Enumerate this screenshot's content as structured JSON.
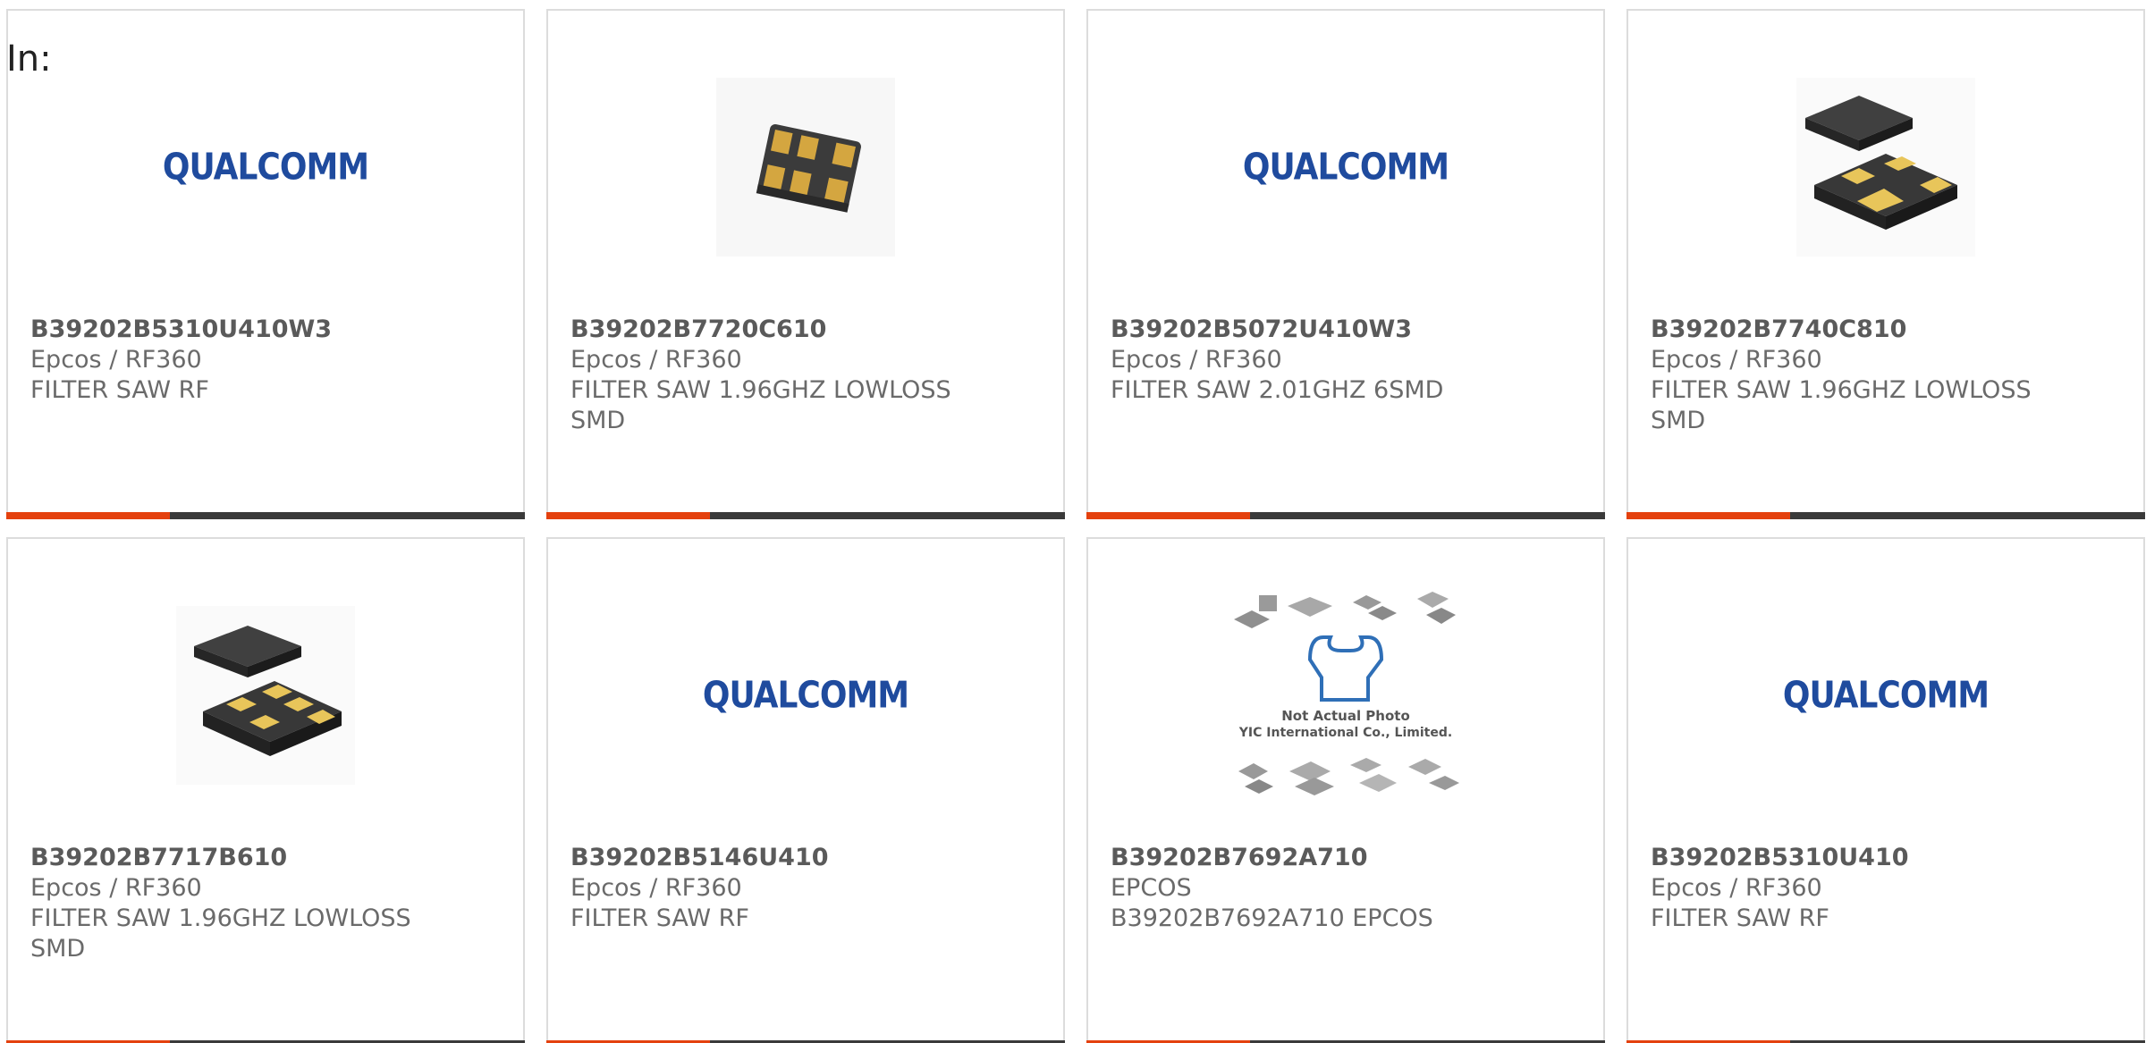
{
  "header": {
    "in_label": "In:"
  },
  "colors": {
    "accent": "#e4410e",
    "bar": "#3a3a3a",
    "qualcomm_blue": "#1f4b9e",
    "border": "#dcdcdc"
  },
  "cards": [
    {
      "image": "qualcomm-logo",
      "logo_text": "QUALCOMM",
      "part_number": "B39202B5310U410W3",
      "manufacturer": "Epcos / RF360",
      "description": "FILTER SAW RF"
    },
    {
      "image": "smd-component-small",
      "part_number": "B39202B7720C610",
      "manufacturer": "Epcos / RF360",
      "description": "FILTER SAW 1.96GHZ LOWLOSS SMD"
    },
    {
      "image": "qualcomm-logo",
      "logo_text": "QUALCOMM",
      "part_number": "B39202B5072U410W3",
      "manufacturer": "Epcos / RF360",
      "description": "FILTER SAW 2.01GHZ 6SMD"
    },
    {
      "image": "smd-component-two-view",
      "part_number": "B39202B7740C810",
      "manufacturer": "Epcos / RF360",
      "description": "FILTER SAW 1.96GHZ LOWLOSS SMD"
    },
    {
      "image": "smd-component-two-view",
      "part_number": "B39202B7717B610",
      "manufacturer": "Epcos / RF360",
      "description": "FILTER SAW 1.96GHZ LOWLOSS SMD"
    },
    {
      "image": "qualcomm-logo",
      "logo_text": "QUALCOMM",
      "part_number": "B39202B5146U410",
      "manufacturer": "Epcos / RF360",
      "description": "FILTER SAW RF"
    },
    {
      "image": "not-actual-photo",
      "placeholder_logo": "YIC",
      "placeholder_line1": "Not Actual Photo",
      "placeholder_line2": "YIC International Co., Limited.",
      "part_number": "B39202B7692A710",
      "manufacturer": "EPCOS",
      "description": "B39202B7692A710 EPCOS"
    },
    {
      "image": "qualcomm-logo",
      "logo_text": "QUALCOMM",
      "part_number": "B39202B5310U410",
      "manufacturer": "Epcos / RF360",
      "description": "FILTER SAW RF"
    }
  ]
}
